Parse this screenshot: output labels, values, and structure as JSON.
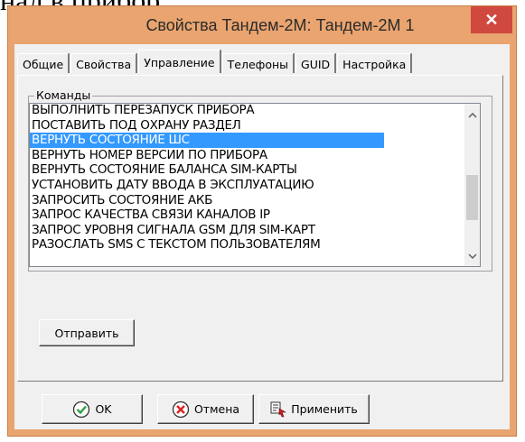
{
  "background_text": "нал в прибор.",
  "window": {
    "title": "Свойства Тандем-2М: Тандем-2М 1",
    "close_symbol": "✕"
  },
  "tabs": [
    {
      "label": "Общие",
      "active": false
    },
    {
      "label": "Свойства",
      "active": false
    },
    {
      "label": "Управление",
      "active": true
    },
    {
      "label": "Телефоны",
      "active": false
    },
    {
      "label": "GUID",
      "active": false
    },
    {
      "label": "Настройка",
      "active": false
    }
  ],
  "commands": {
    "group_label": "Команды",
    "items": [
      "ВЫПОЛНИТЬ ПЕРЕЗАПУСК ПРИБОРА",
      "ПОСТАВИТЬ ПОД ОХРАНУ РАЗДЕЛ",
      "ВЕРНУТЬ СОСТОЯНИЕ ШС",
      "ВЕРНУТЬ НОМЕР ВЕРСИИ ПО ПРИБОРА",
      "ВЕРНУТЬ СОСТОЯНИЕ БАЛАНСА SIM-КАРТЫ",
      "УСТАНОВИТЬ ДАТУ ВВОДА В ЭКСПЛУАТАЦИЮ",
      "ЗАПРОСИТЬ СОСТОЯНИЕ АКБ",
      "ЗАПРОС КАЧЕСТВА СВЯЗИ КАНАЛОВ IP",
      "ЗАПРОС УРОВНЯ СИГНАЛА GSM ДЛЯ SIM-КАРТ",
      "РАЗОСЛАТЬ SMS С ТЕКСТОМ ПОЛЬЗОВАТЕЛЯМ"
    ],
    "selected": "ВЕРНУТЬ СОСТОЯНИЕ ШС"
  },
  "buttons": {
    "send": "Отправить",
    "ok": "OK",
    "cancel": "Отмена",
    "apply": "Применить"
  },
  "icons": {
    "ok": "check-circle-icon",
    "cancel": "x-circle-icon",
    "apply": "apply-icon"
  },
  "colors": {
    "title_bar": "#e9a46f",
    "close_button": "#d0493e",
    "selection": "#3399ff",
    "ok_icon": "#2ea043",
    "cancel_icon": "#e02020"
  }
}
